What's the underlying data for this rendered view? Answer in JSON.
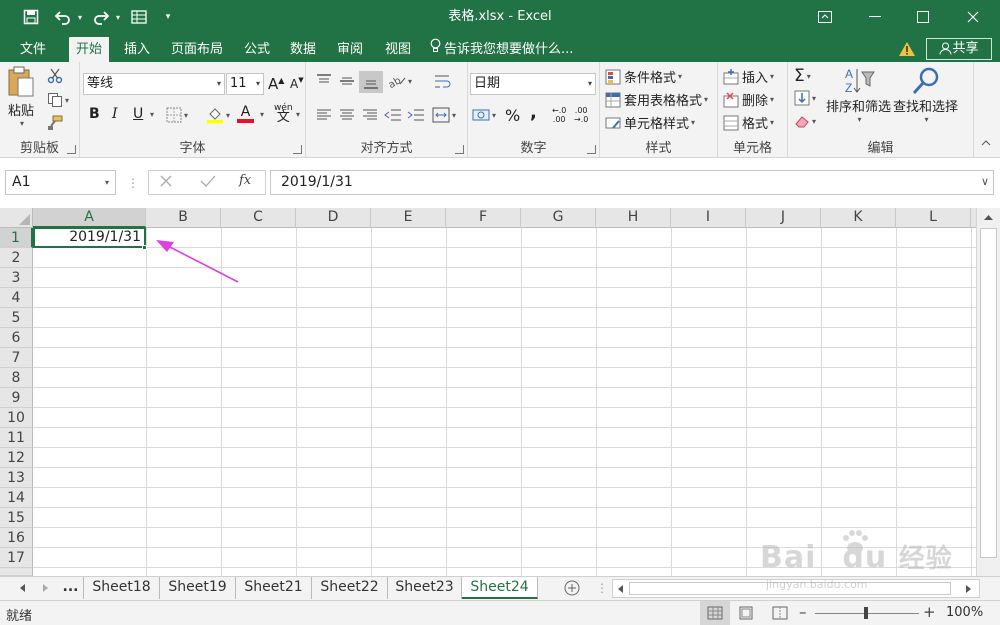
{
  "titlebar": {
    "title": "表格.xlsx - Excel",
    "bg_color": "#217346"
  },
  "menu": {
    "tabs": [
      "文件",
      "开始",
      "插入",
      "页面布局",
      "公式",
      "数据",
      "审阅",
      "视图"
    ],
    "active_tab": "开始",
    "tell_me": "告诉我您想要做什么...",
    "share": "共享"
  },
  "ribbon": {
    "clipboard": {
      "paste": "粘贴",
      "label": "剪贴板"
    },
    "font": {
      "name": "等线",
      "size": "11",
      "label": "字体",
      "bold": "B",
      "italic": "I",
      "underline": "U",
      "font_color": "A",
      "grow": "A",
      "shrink": "A",
      "phonetic": "wén"
    },
    "alignment": {
      "label": "对齐方式"
    },
    "number": {
      "format": "日期",
      "percent": "%",
      "comma": ",",
      "label": "数字"
    },
    "styles": {
      "conditional": "条件格式",
      "table": "套用表格格式",
      "cell": "单元格样式",
      "label": "样式"
    },
    "cells": {
      "insert": "插入",
      "delete": "删除",
      "format": "格式",
      "label": "单元格"
    },
    "editing": {
      "sort": "排序和筛选",
      "find": "查找和选择",
      "label": "编辑",
      "sum": "Σ"
    }
  },
  "formula_bar": {
    "name_box": "A1",
    "fx": "fx",
    "value": "2019/1/31"
  },
  "grid": {
    "columns": [
      "A",
      "B",
      "C",
      "D",
      "E",
      "F",
      "G",
      "H",
      "I",
      "J",
      "K",
      "L"
    ],
    "rows": [
      "1",
      "2",
      "3",
      "4",
      "5",
      "6",
      "7",
      "8",
      "9",
      "10",
      "11",
      "12",
      "13",
      "14",
      "15",
      "16",
      "17"
    ],
    "selected_cell": "A1",
    "a1_value": "2019/1/31"
  },
  "sheets": {
    "more": "...",
    "tabs": [
      "Sheet18",
      "Sheet19",
      "Sheet21",
      "Sheet22",
      "Sheet23",
      "Sheet24"
    ],
    "active": "Sheet24"
  },
  "status": {
    "mode": "就绪",
    "zoom": "100%"
  },
  "watermark": {
    "brand": "Bai",
    "brand2": "du",
    "cn": "经验",
    "url": "jingyan.baidu.com"
  },
  "colors": {
    "accent": "#217346",
    "annotation_arrow": "#e040e0"
  }
}
